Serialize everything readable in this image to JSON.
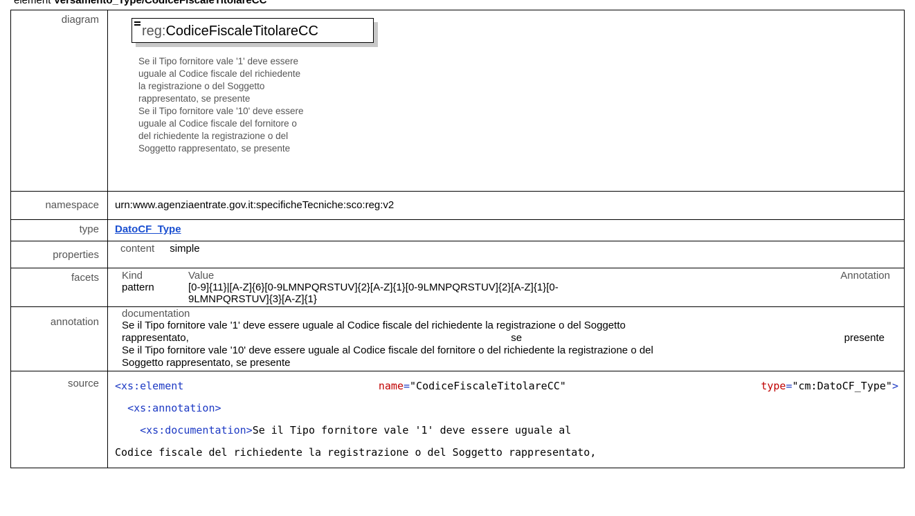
{
  "heading": {
    "prefix": "element ",
    "title": "Versamento_Type/CodiceFiscaleTitolareCC"
  },
  "labels": {
    "diagram": "diagram",
    "namespace": "namespace",
    "type": "type",
    "properties": "properties",
    "facets": "facets",
    "annotation": "annotation",
    "source": "source"
  },
  "diagram": {
    "prefix": "reg:",
    "name": "CodiceFiscaleTitolareCC",
    "doc": "Se il Tipo fornitore vale '1' deve essere\nuguale al Codice fiscale del richiedente\nla registrazione o del Soggetto\nrappresentato, se presente\nSe il Tipo fornitore vale '10' deve essere\nuguale al Codice fiscale del fornitore o\ndel richiedente la registrazione o del\nSoggetto rappresentato, se presente"
  },
  "namespace": "urn:www.agenziaentrate.gov.it:specificheTecniche:sco:reg:v2",
  "type_link": "DatoCF_Type",
  "properties": {
    "key": "content",
    "value": "simple"
  },
  "facets": {
    "headers": {
      "kind": "Kind",
      "value": "Value",
      "annotation": "Annotation"
    },
    "row": {
      "kind": "pattern",
      "value_line1": "[0-9]{11}|[A-Z]{6}[0-9LMNPQRSTUV]{2}[A-Z]{1}[0-9LMNPQRSTUV]{2}[A-Z]{1}[0-",
      "value_line2": "9LMNPQRSTUV]{3}[A-Z]{1}"
    }
  },
  "annotation": {
    "header": "documentation",
    "line1": "Se il Tipo fornitore vale '1' deve essere uguale al Codice fiscale del richiedente la registrazione o del Soggetto",
    "line2_a": "rappresentato,",
    "line2_b": "se",
    "line2_c": "presente",
    "line3": "Se il Tipo fornitore vale '10' deve essere uguale al Codice fiscale del fornitore o del richiedente la registrazione o del",
    "line4": "Soggetto rappresentato, se presente"
  },
  "source": {
    "l1_tag": "<xs:element",
    "l1_attr1": "name",
    "l1_val1": "\"CodiceFiscaleTitolareCC\"",
    "l1_attr2": "type",
    "l1_val2": "\"cm:DatoCF_Type\"",
    "l1_close": ">",
    "l2_tag": "<xs:annotation>",
    "l3_tag": "<xs:documentation>",
    "l3_text": "Se il Tipo fornitore vale '1' deve essere uguale al",
    "l4_text": "Codice fiscale del richiedente la registrazione o del Soggetto rappresentato,"
  }
}
